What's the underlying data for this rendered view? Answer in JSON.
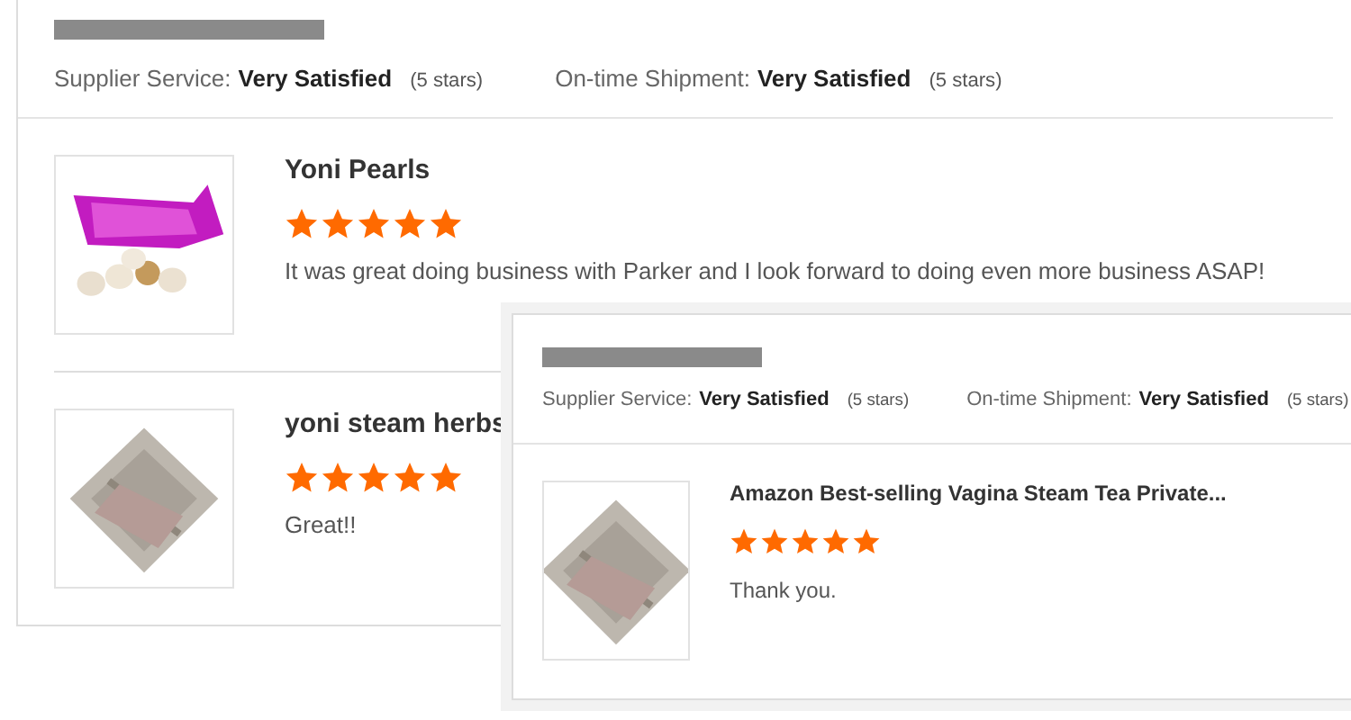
{
  "panels": [
    {
      "ratings": [
        {
          "label": "Supplier Service:",
          "value": "Very Satisfied",
          "count": "(5 stars)"
        },
        {
          "label": "On-time Shipment:",
          "value": "Very Satisfied",
          "count": "(5 stars)"
        }
      ],
      "reviews": [
        {
          "product": "Yoni Pearls",
          "stars": 5,
          "comment": "It was great doing business with Parker and I look forward to doing even more business ASAP!"
        },
        {
          "product": "yoni steam herbs",
          "stars": 5,
          "comment": "Great!!"
        }
      ]
    },
    {
      "ratings": [
        {
          "label": "Supplier Service:",
          "value": "Very Satisfied",
          "count": "(5 stars)"
        },
        {
          "label": "On-time Shipment:",
          "value": "Very Satisfied",
          "count": "(5 stars)"
        }
      ],
      "reviews": [
        {
          "product": "Amazon Best-selling Vagina Steam Tea Private...",
          "stars": 5,
          "comment": "Thank you."
        }
      ]
    }
  ]
}
